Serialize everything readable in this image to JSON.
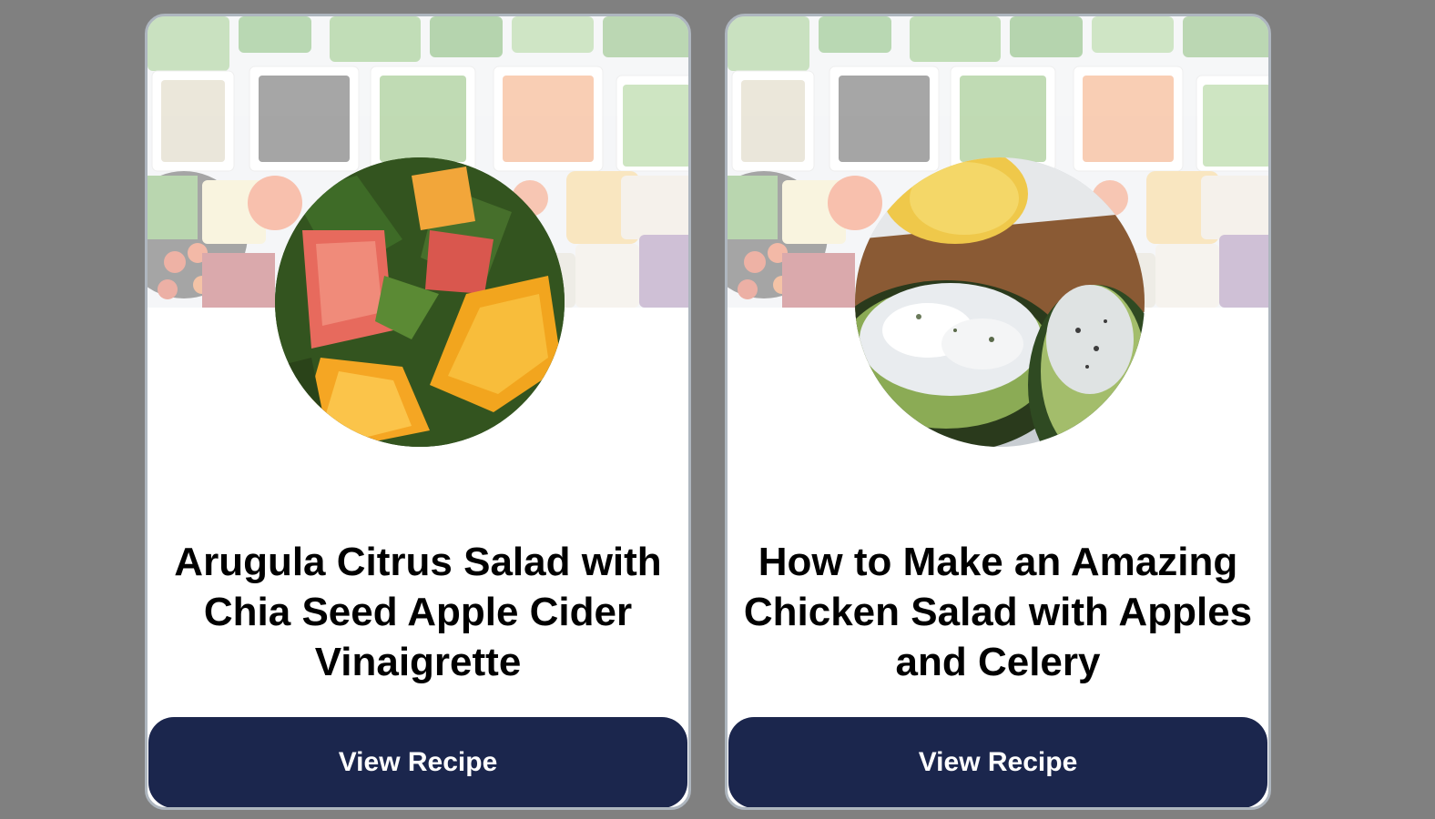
{
  "cards": [
    {
      "title": "Arugula Citrus Salad with Chia Seed Apple Cider Vinaigrette",
      "button_label": "View Recipe"
    },
    {
      "title": "How to Make an Amazing Chicken Salad with Apples and Celery",
      "button_label": "View Recipe"
    }
  ],
  "colors": {
    "page_background": "#808080",
    "card_background": "#ffffff",
    "card_border": "#aeb6bf",
    "button_background": "#1b264d",
    "button_text": "#ffffff",
    "title_text": "#000000"
  }
}
